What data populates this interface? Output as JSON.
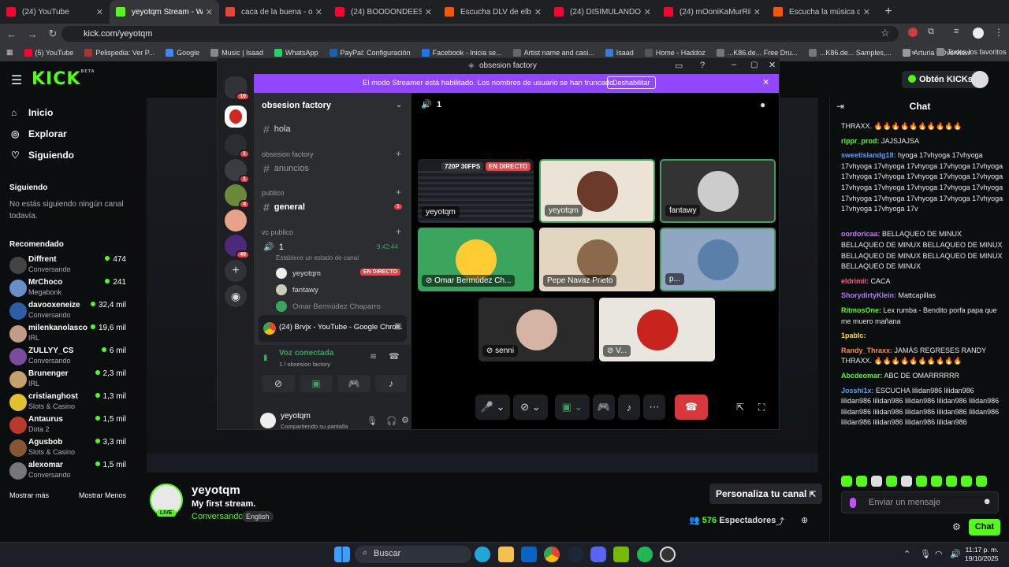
{
  "browser": {
    "tabs": [
      {
        "title": "(24) YouTube",
        "color": "#ff0033"
      },
      {
        "title": "yeyotqm Stream - Watch",
        "color": "#53fc18"
      },
      {
        "title": "caca de la buena - obse",
        "color": "#ea4335"
      },
      {
        "title": "(24) BOODÓNDEESTÁS! (",
        "color": "#ff0033"
      },
      {
        "title": "Escucha DLV de elbrvjo |",
        "color": "#ff5500"
      },
      {
        "title": "(24) DISIMULANDO - You",
        "color": "#ff0033"
      },
      {
        "title": "(24) mOoniKaMurRillÖ - ",
        "color": "#ff0033"
      },
      {
        "title": "Escucha la música de Yey",
        "color": "#ff5500"
      }
    ],
    "active_tab": 1,
    "url": "kick.com/yeyotqm",
    "bookmarks": [
      "(5) YouTube",
      "Pelispedia: Ver P...",
      "Google",
      "Music | Isaad",
      "WhatsApp",
      "PayPal: Configuración",
      "Facebook - Inicia se...",
      "Artist name and casi...",
      "Isaad",
      "Home - Haddoz",
      "...K86.de... Free Dru...",
      "...K86.de... Samples,...",
      "Arturia - Overview"
    ],
    "bookmarks_all": "Todos los favoritos"
  },
  "kick": {
    "logo": "KICK",
    "beta": "BETA",
    "nav": [
      "Inicio",
      "Explorar",
      "Siguiendo"
    ],
    "following_title": "Siguiendo",
    "following_empty": "No estás siguiendo ningún canal todavía.",
    "recommended_title": "Recomendado",
    "recommended": [
      {
        "name": "Diffrent",
        "cat": "Conversando",
        "viewers": "474",
        "color": "#444"
      },
      {
        "name": "MrChoco",
        "cat": "Megabonk",
        "viewers": "241",
        "color": "#6a8ec8"
      },
      {
        "name": "davooxeneize",
        "cat": "Conversando",
        "viewers": "32,4 mil",
        "color": "#2c5ea8"
      },
      {
        "name": "milenkanolasco",
        "cat": "IRL",
        "viewers": "19,6 mil",
        "color": "#c49a88"
      },
      {
        "name": "ZULLYY_CS",
        "cat": "Conversando",
        "viewers": "6 mil",
        "color": "#7b4b9e"
      },
      {
        "name": "Brunenger",
        "cat": "IRL",
        "viewers": "2,3 mil",
        "color": "#c4a06a"
      },
      {
        "name": "cristianghost",
        "cat": "Slots & Casino",
        "viewers": "1,3 mil",
        "color": "#e0c22e"
      },
      {
        "name": "Antaurus",
        "cat": "Dota 2",
        "viewers": "1,5 mil",
        "color": "#b83a2b"
      },
      {
        "name": "Agusbob",
        "cat": "Slots & Casino",
        "viewers": "3,3 mil",
        "color": "#885533"
      },
      {
        "name": "alexomar",
        "cat": "Conversando",
        "viewers": "1,5 mil",
        "color": "#777"
      }
    ],
    "show_more": "Mostrar más",
    "show_less": "Mostrar Menos",
    "get_kicks": "Obtén KICKs",
    "streamer": {
      "name": "yeyotqm",
      "title": "My first stream.",
      "category": "Conversando",
      "language": "English",
      "live": "LIVE",
      "viewers": "576",
      "viewers_label": "Espectadores",
      "customize": "Personaliza tu canal"
    },
    "chat": {
      "title": "Chat",
      "messages": [
        {
          "user": "",
          "text": "THRAXX. 🔥🔥🔥🔥🔥🔥🔥🔥🔥🔥",
          "color": "#ffffff"
        },
        {
          "user": "rippr_prod:",
          "text": "JAJSJAJSA",
          "color": "#53fc18"
        },
        {
          "user": "sweetislandg18:",
          "text": "hyoga 17vhyoga 17vhyoga 17vhyoga 17vhyoga 17vhyoga 17vhyoga 17vhyoga 17vhyoga 17vhyoga 17vhyoga 17vhyoga 17vhyoga 17vhyoga 17vhyoga 17vhyoga 17vhyoga 17vhyoga 17vhyoga 17vhyoga 17vhyoga 17vhyoga 17vhyoga 17vhyoga 17vhyoga 17v",
          "color": "#5b9bff"
        },
        {
          "user": "oordoricaa:",
          "text": "BELLAQUEO DE MINUX BELLAQUEO DE MINUX BELLAQUEO DE MINUX BELLAQUEO DE MINUX BELLAQUEO DE MINUX BELLAQUEO DE MINUX",
          "color": "#c07bff"
        },
        {
          "user": "eldrimii:",
          "text": "CACA",
          "color": "#ff5c7a"
        },
        {
          "user": "ShorydirtyKlein:",
          "text": "Mattcapillas",
          "color": "#b07bff"
        },
        {
          "user": "RitmosOne:",
          "text": "Lex rumba - Bendito porfa papa que me muero mañana",
          "color": "#53fc18"
        },
        {
          "user": "1pablc:",
          "text": "",
          "color": "#ffdd33"
        },
        {
          "user": "Randy_Thraxx:",
          "text": "JAMÁS REGRESES RANDY THRAXX. 🔥🔥🔥🔥🔥🔥🔥🔥🔥🔥",
          "color": "#ff8b3d"
        },
        {
          "user": "Abcdeomar:",
          "text": "ABC DE OMARRRRRR",
          "color": "#53fc18"
        },
        {
          "user": "Josshi1x:",
          "text": "ESCUCHA lilidan986 lilidan986 lilidan986 lilidan986 lilidan986 lilidan986 lilidan986 lilidan986 lilidan986 lilidan986 lilidan986 lilidan986 lilidan986 lilidan986 lilidan986 lilidan986",
          "color": "#5b9bff"
        }
      ],
      "input_placeholder": "Enviar un mensaje",
      "send": "Chat"
    }
  },
  "discord": {
    "window_title": "obsesion factory",
    "banner": "El modo Streamer está habilitado. Los nombres de usuario se han truncado.",
    "banner_btn": "Deshabilitar",
    "server": "obsesion factory",
    "channels": {
      "hola": "hola",
      "cat1": "obsesion factory",
      "anuncios": "anuncios",
      "cat2": "publico",
      "general": "general",
      "general_badge": "1",
      "cat3": "vc publico",
      "voice": "1",
      "voice_time": "9:42:44",
      "voice_status": "Establece un estado de canal",
      "users": [
        {
          "name": "yeyotqm",
          "badge": "EN DIRECTO",
          "color": "#eee"
        },
        {
          "name": "fantawy",
          "badge": "",
          "color": "#ccb"
        },
        {
          "name": "Omar Bermúdez Chaparro",
          "badge": "",
          "color": "#3ba55d"
        }
      ]
    },
    "screenshare": "(24) Brvjx - YouTube - Google Chro...",
    "voice_connected": "Voz conectada",
    "voice_where": "1 / obsesion factory",
    "me_name": "yeyotqm",
    "me_status": "Compartiendo su pantalla",
    "stage_channel": "1",
    "guild_badges": [
      "10",
      "1",
      "1",
      "4",
      "40"
    ],
    "tiles": [
      {
        "name": "yeyotqm",
        "badge1": "720P 30FPS",
        "badge2": "EN DIRECTO",
        "bg": "#1b1e22"
      },
      {
        "name": "yeyotqm",
        "bg": "#ebe4d6"
      },
      {
        "name": "fantawy",
        "bg": "#333"
      },
      {
        "name": "Omar Bermúdez Ch...",
        "bg": "#3ba55d"
      },
      {
        "name": "Pepe Navaz Prieto",
        "bg": "#e3d6c0"
      },
      {
        "name": "p...",
        "bg": "#8fa7c2"
      },
      {
        "name": "senni",
        "bg": "#2a2a2a"
      },
      {
        "name": "V...",
        "bg": "#e8e6df"
      }
    ]
  },
  "taskbar": {
    "search": "Buscar",
    "time": "11:17 p. m.",
    "date": "19/10/2025"
  }
}
